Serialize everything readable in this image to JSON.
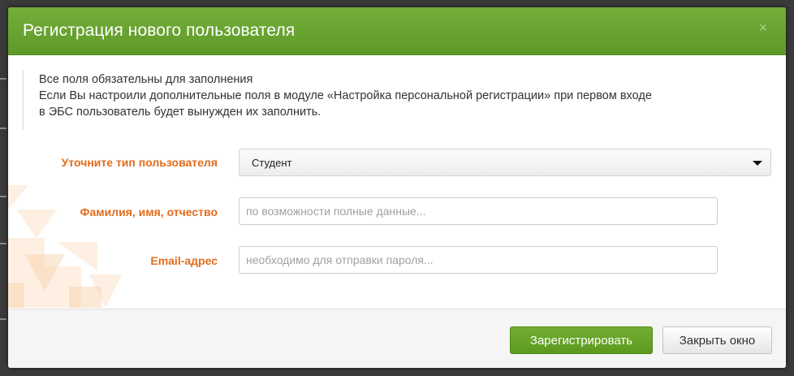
{
  "dialog": {
    "title": "Регистрация нового пользователя",
    "close_glyph": "×",
    "notice": {
      "line1": "Все поля обязательны для заполнения",
      "line2": "Если Вы настроили дополнительные поля в модуле «Настройка персональной регистрации» при первом входе",
      "line3": "в ЭБС пользователь будет вынужден их заполнить."
    },
    "fields": {
      "user_type": {
        "label": "Уточните тип пользователя",
        "value": "Студент"
      },
      "full_name": {
        "label": "Фамилия, имя, отчество",
        "value": "",
        "placeholder": "по возможности полные данные..."
      },
      "email": {
        "label": "Email-адрес",
        "value": "",
        "placeholder": "необходимо для отправки пароля..."
      }
    },
    "buttons": {
      "register": "Зарегистрировать",
      "close": "Закрыть окно"
    }
  },
  "colors": {
    "header_green": "#6aa532",
    "label_orange": "#e36c1b",
    "primary_button": "#66a328"
  },
  "icons": {
    "close": "close-icon",
    "dropdown": "chevron-down-icon"
  }
}
